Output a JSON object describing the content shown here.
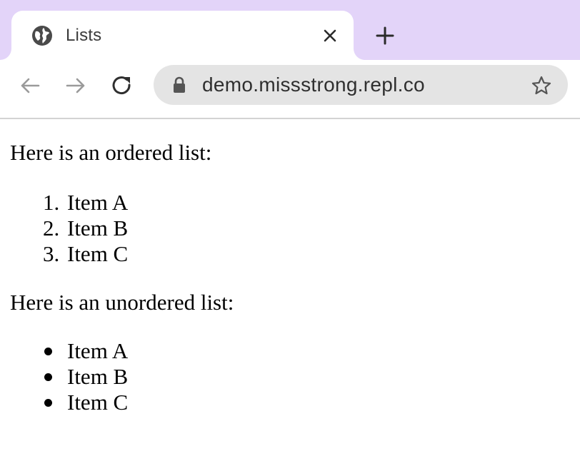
{
  "browser": {
    "tab": {
      "title": "Lists",
      "favicon_icon": "globe-icon",
      "close_icon": "close-icon"
    },
    "new_tab_icon": "plus-icon",
    "toolbar": {
      "back_icon": "arrow-left-icon",
      "forward_icon": "arrow-right-icon",
      "reload_icon": "reload-icon",
      "lock_icon": "lock-icon",
      "url": "demo.missstrong.repl.co",
      "bookmark_icon": "star-icon"
    },
    "colors": {
      "tabstrip_bg": "#e3d4f9",
      "omnibox_bg": "#e4e4e4"
    }
  },
  "page": {
    "ordered_intro": "Here is an ordered list:",
    "ordered_items": [
      {
        "marker": "1.",
        "label": "Item A"
      },
      {
        "marker": "2.",
        "label": "Item B"
      },
      {
        "marker": "3.",
        "label": "Item C"
      }
    ],
    "unordered_intro": "Here is an unordered list:",
    "unordered_items": [
      {
        "label": "Item A"
      },
      {
        "label": "Item B"
      },
      {
        "label": "Item C"
      }
    ]
  }
}
